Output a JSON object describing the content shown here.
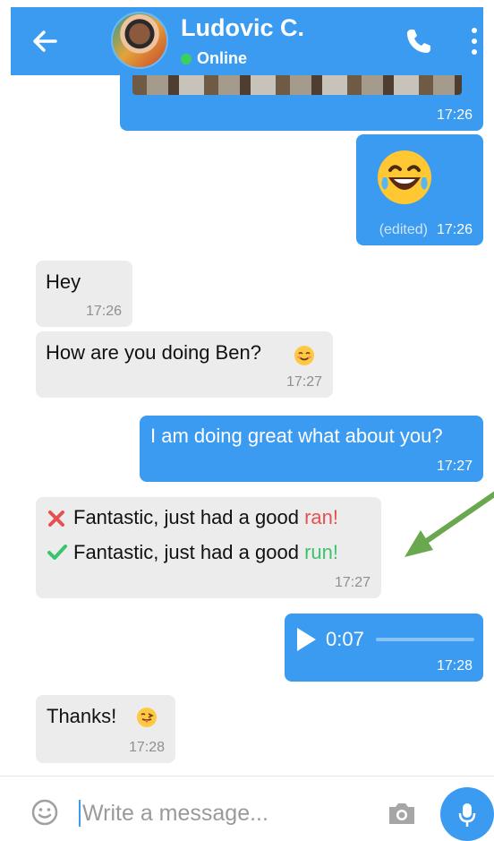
{
  "header": {
    "name": "Ludovic C.",
    "status": "Online"
  },
  "messages": {
    "photo_time": "17:26",
    "emoji_edited": "(edited)",
    "emoji_time": "17:26",
    "hey_text": "Hey",
    "hey_time": "17:26",
    "how_text": "How are you doing Ben?",
    "how_time": "17:27",
    "great_text": "I am doing great what about you?",
    "great_time": "17:27",
    "correction_wrong_prefix": "Fantastic, just had a good ",
    "correction_wrong_word": "ran!",
    "correction_right_prefix": "Fantastic, just had a good ",
    "correction_right_word": "run!",
    "correction_time": "17:27",
    "voice_duration": "0:07",
    "voice_time": "17:28",
    "thanks_text": "Thanks!",
    "thanks_time": "17:28"
  },
  "voice_progress": 0,
  "composer": {
    "placeholder": "Write a message..."
  },
  "colors": {
    "accent": "#3b9bf0",
    "incoming": "#ececec",
    "wrong": "#e55151",
    "right": "#3bc46c",
    "annotation_arrow": "#69a84f"
  },
  "icons": [
    "back-arrow-icon",
    "avatar",
    "phone-icon",
    "more-vertical-icon",
    "laughing-emoji-icon",
    "smiling-emoji-icon",
    "cross-icon",
    "check-icon",
    "play-icon",
    "tongue-emoji-icon",
    "emoji-icon",
    "camera-icon",
    "microphone-icon"
  ]
}
